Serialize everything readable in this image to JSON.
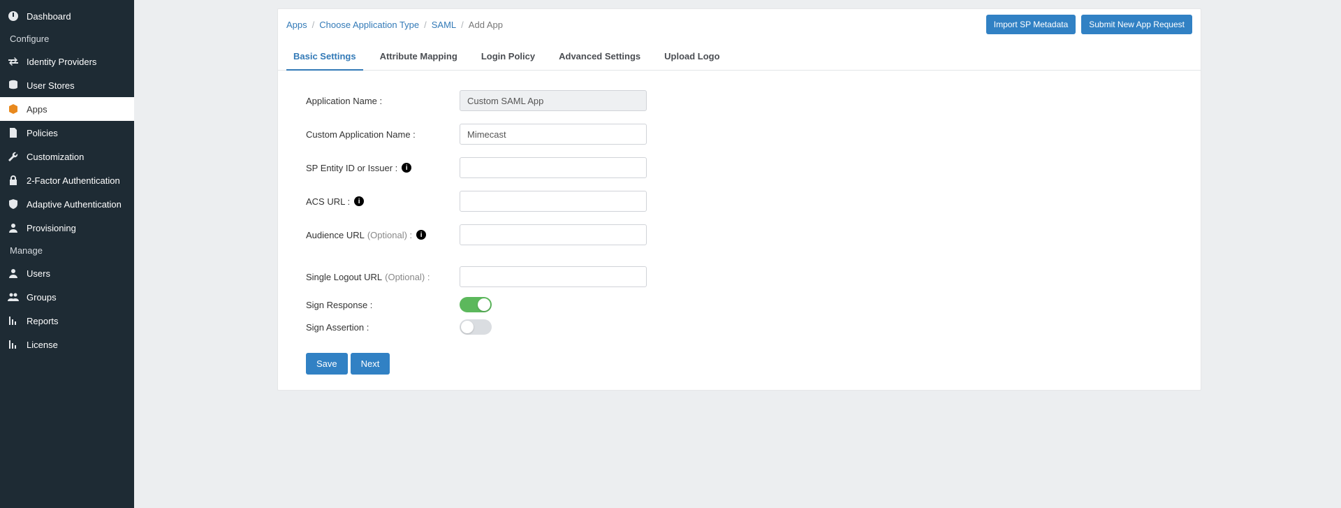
{
  "sidebar": {
    "items": [
      {
        "label": "Dashboard"
      },
      {
        "section": "Configure"
      },
      {
        "label": "Identity Providers"
      },
      {
        "label": "User Stores"
      },
      {
        "label": "Apps",
        "active": true
      },
      {
        "label": "Policies"
      },
      {
        "label": "Customization"
      },
      {
        "label": "2-Factor Authentication"
      },
      {
        "label": "Adaptive Authentication"
      },
      {
        "label": "Provisioning"
      },
      {
        "section": "Manage"
      },
      {
        "label": "Users"
      },
      {
        "label": "Groups"
      },
      {
        "label": "Reports"
      },
      {
        "label": "License"
      }
    ]
  },
  "breadcrumb": {
    "crumbs": [
      "Apps",
      "Choose Application Type",
      "SAML",
      "Add App"
    ]
  },
  "header_buttons": {
    "import": "Import SP Metadata",
    "submit": "Submit New App Request"
  },
  "tabs": {
    "items": [
      "Basic Settings",
      "Attribute Mapping",
      "Login Policy",
      "Advanced Settings",
      "Upload Logo"
    ],
    "active_index": 0
  },
  "form": {
    "app_name_label": "Application Name :",
    "app_name_value": "Custom SAML App",
    "custom_name_label": "Custom Application Name :",
    "custom_name_value": "Mimecast",
    "sp_entity_label": "SP Entity ID or Issuer :",
    "sp_entity_value": "",
    "acs_url_label": "ACS URL :",
    "acs_url_value": "",
    "audience_url_label": "Audience URL",
    "audience_url_optional": "(Optional) :",
    "audience_url_value": "",
    "slo_url_label": "Single Logout URL",
    "slo_url_optional": "(Optional) :",
    "slo_url_value": "",
    "sign_response_label": "Sign Response :",
    "sign_response_on": true,
    "sign_assertion_label": "Sign Assertion :",
    "sign_assertion_on": false
  },
  "footer": {
    "save": "Save",
    "next": "Next"
  }
}
